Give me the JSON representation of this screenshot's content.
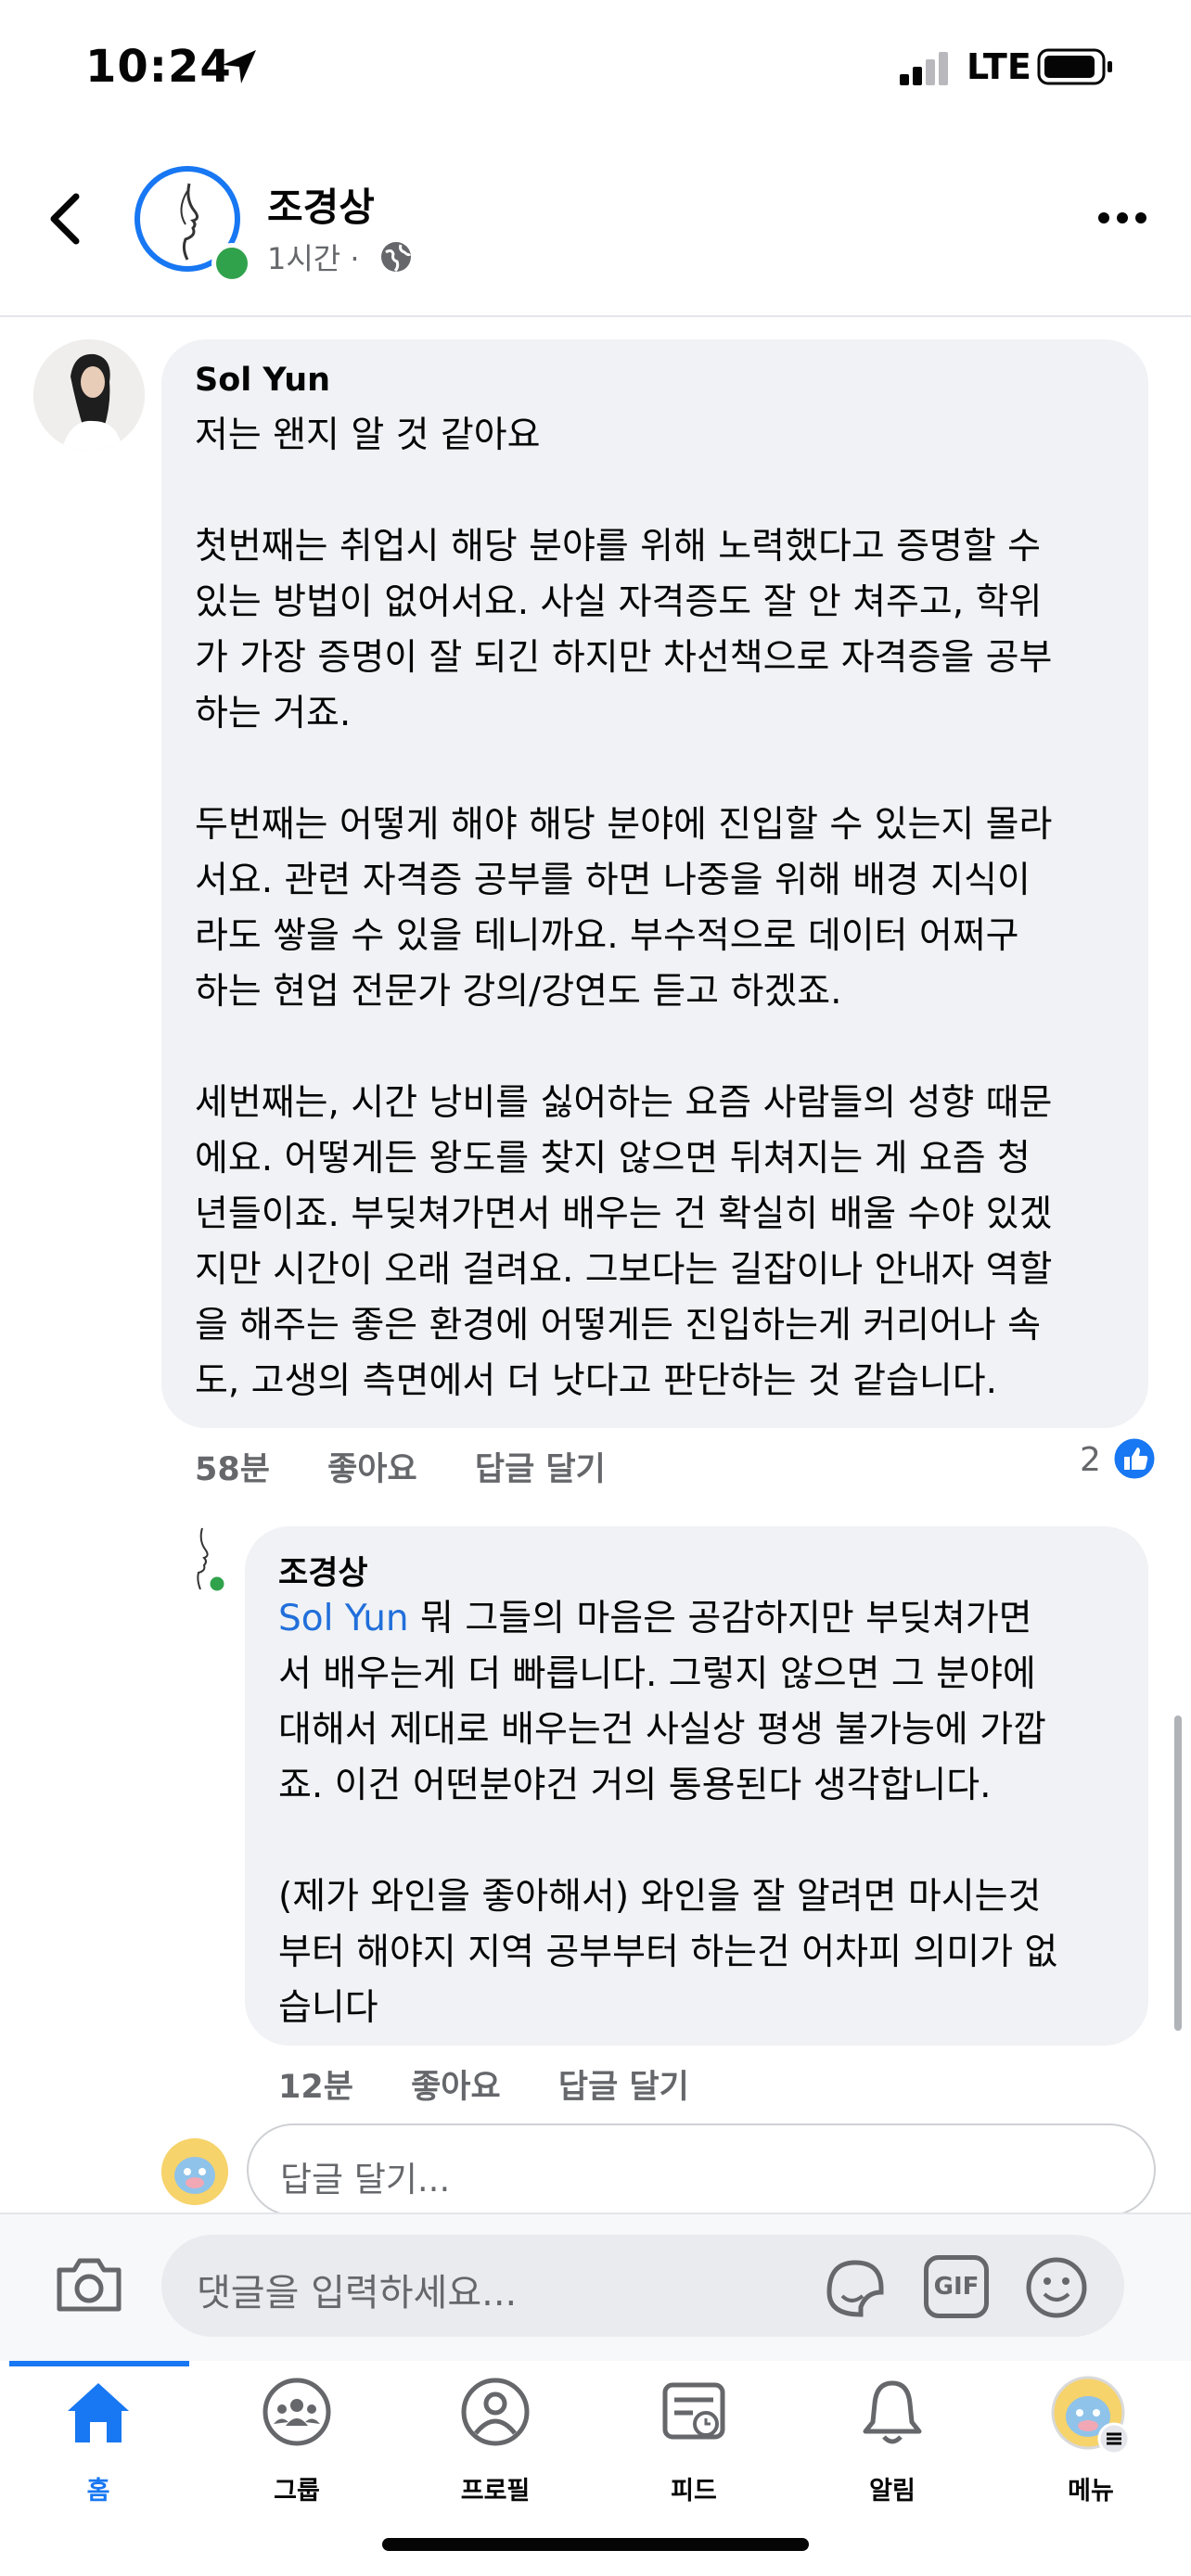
{
  "status_bar": {
    "time": "10:24",
    "network": "LTE"
  },
  "header": {
    "author": "조경상",
    "time": "1시간",
    "dot": "·"
  },
  "comments": [
    {
      "name": "Sol Yun",
      "text": "저는 왠지 알 것 같아요\n\n첫번째는 취업시 해당 분야를 위해 노력했다고 증명할 수\n있는 방법이 없어서요. 사실 자격증도 잘 안 쳐주고, 학위\n가 가장 증명이 잘 되긴 하지만 차선책으로 자격증을 공부\n하는 거죠.\n\n두번째는 어떻게 해야 해당 분야에 진입할 수 있는지 몰라\n서요. 관련 자격증 공부를 하면 나중을 위해 배경 지식이\n라도 쌓을 수 있을 테니까요. 부수적으로 데이터 어쩌구\n하는 현업 전문가 강의/강연도 듣고 하겠죠.\n\n세번째는, 시간 낭비를 싫어하는 요즘 사람들의 성향 때문\n에요. 어떻게든 왕도를 찾지 않으면 뒤쳐지는 게 요즘 청\n년들이죠. 부딪쳐가면서 배우는 건 확실히 배울 수야 있겠\n지만 시간이 오래 걸려요. 그보다는 길잡이나 안내자 역할\n을 해주는 좋은 환경에 어떻게든 진입하는게 커리어나 속\n도, 고생의 측면에서 더 낫다고 판단하는 것 같습니다.",
      "time": "58분",
      "like": "좋아요",
      "reply": "답글 달기",
      "reaction_count": "2"
    },
    {
      "name": "조경상",
      "mention": "Sol Yun",
      "text": " 뭐 그들의 마음은 공감하지만 부딪쳐가면\n서 배우는게 더 빠릅니다. 그렇지 않으면 그 분야에\n대해서 제대로 배우는건 사실상 평생 불가능에 가깝\n죠. 이건 어떤분야건 거의 통용된다 생각합니다.\n\n(제가 와인을 좋아해서) 와인을 잘 알려면 마시는것\n부터 해야지 지역 공부부터 하는건 어차피 의미가 없\n습니다",
      "time": "12분",
      "like": "좋아요",
      "reply": "답글 달기"
    }
  ],
  "reply_input": {
    "placeholder": "답글 달기..."
  },
  "composer": {
    "placeholder": "댓글을 입력하세요...",
    "gif_label": "GIF"
  },
  "nav": {
    "items": [
      {
        "label": "홈",
        "icon": "home-icon"
      },
      {
        "label": "그룹",
        "icon": "groups-icon"
      },
      {
        "label": "프로필",
        "icon": "profile-icon"
      },
      {
        "label": "피드",
        "icon": "feed-icon"
      },
      {
        "label": "알림",
        "icon": "bell-icon"
      },
      {
        "label": "메뉴",
        "icon": "menu-icon"
      }
    ]
  },
  "colors": {
    "accent": "#1877f2",
    "online": "#31a24c",
    "bubble": "#f0f2f5",
    "mention": "#216fdb"
  }
}
